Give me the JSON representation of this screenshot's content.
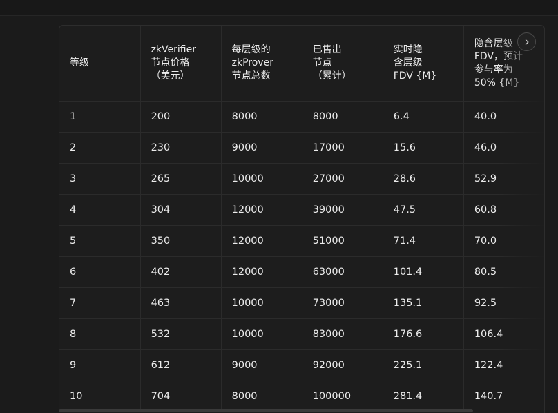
{
  "table": {
    "headers": [
      [
        "等级"
      ],
      [
        "zkVerifier",
        "节点价格",
        "（美元）"
      ],
      [
        "每层级的",
        "zkProver",
        "节点总数"
      ],
      [
        "已售出",
        "节点",
        "（累计）"
      ],
      [
        "实时隐",
        "含层级",
        "FDV {M}"
      ],
      [
        "隐含层级",
        "FDV，预计",
        "参与率为",
        "50% {M}"
      ]
    ],
    "rows": [
      [
        "1",
        "200",
        "8000",
        "8000",
        "6.4",
        "40.0"
      ],
      [
        "2",
        "230",
        "9000",
        "17000",
        "15.6",
        "46.0"
      ],
      [
        "3",
        "265",
        "10000",
        "27000",
        "28.6",
        "52.9"
      ],
      [
        "4",
        "304",
        "12000",
        "39000",
        "47.5",
        "60.8"
      ],
      [
        "5",
        "350",
        "12000",
        "51000",
        "71.4",
        "70.0"
      ],
      [
        "6",
        "402",
        "12000",
        "63000",
        "101.4",
        "80.5"
      ],
      [
        "7",
        "463",
        "10000",
        "73000",
        "135.1",
        "92.5"
      ],
      [
        "8",
        "532",
        "10000",
        "83000",
        "176.6",
        "106.4"
      ],
      [
        "9",
        "612",
        "9000",
        "92000",
        "225.1",
        "122.4"
      ],
      [
        "10",
        "704",
        "8000",
        "100000",
        "281.4",
        "140.7"
      ]
    ]
  },
  "controls": {
    "scroll_right_icon": "chevron-right-icon"
  }
}
